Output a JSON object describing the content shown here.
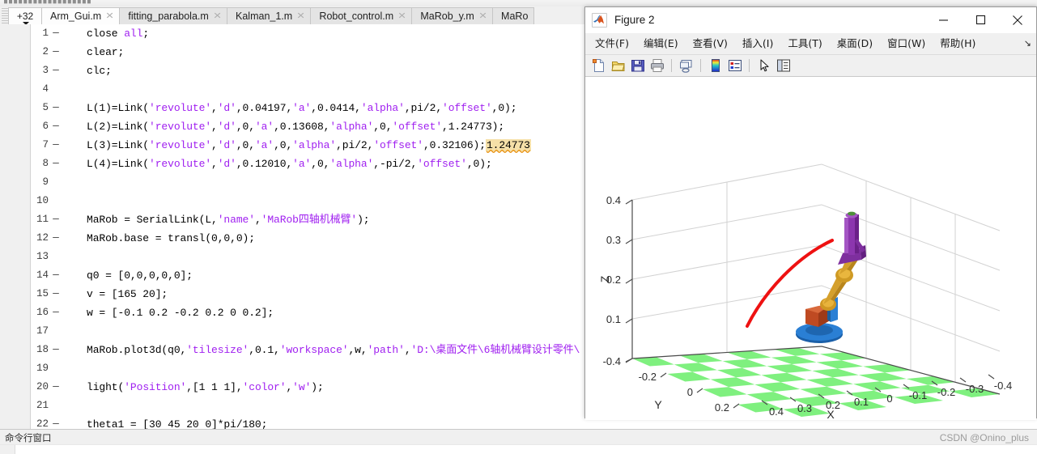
{
  "editor": {
    "tab_overflow_label": "+32",
    "tabs": [
      {
        "label": "Arm_Gui.m",
        "close": "✕",
        "active": true
      },
      {
        "label": "fitting_parabola.m",
        "close": "✕",
        "active": false
      },
      {
        "label": "Kalman_1.m",
        "close": "✕",
        "active": false
      },
      {
        "label": "Robot_control.m",
        "close": "✕",
        "active": false
      },
      {
        "label": "MaRob_y.m",
        "close": "✕",
        "active": false
      },
      {
        "label": "MaRo",
        "close": "",
        "active": false
      }
    ],
    "lines": [
      {
        "num": "1",
        "dash": "—",
        "segments": [
          {
            "t": "close ",
            "c": "p"
          },
          {
            "t": "all",
            "c": "k"
          },
          {
            "t": ";",
            "c": "p"
          }
        ]
      },
      {
        "num": "2",
        "dash": "—",
        "segments": [
          {
            "t": "clear;",
            "c": "p"
          }
        ]
      },
      {
        "num": "3",
        "dash": "—",
        "segments": [
          {
            "t": "clc;",
            "c": "p"
          }
        ]
      },
      {
        "num": "4",
        "dash": "",
        "segments": []
      },
      {
        "num": "5",
        "dash": "—",
        "segments": [
          {
            "t": "L(1)=Link(",
            "c": "p"
          },
          {
            "t": "'revolute'",
            "c": "s"
          },
          {
            "t": ",",
            "c": "p"
          },
          {
            "t": "'d'",
            "c": "s"
          },
          {
            "t": ",0.04197,",
            "c": "p"
          },
          {
            "t": "'a'",
            "c": "s"
          },
          {
            "t": ",0.0414,",
            "c": "p"
          },
          {
            "t": "'alpha'",
            "c": "s"
          },
          {
            "t": ",pi/2,",
            "c": "p"
          },
          {
            "t": "'offset'",
            "c": "s"
          },
          {
            "t": ",0);",
            "c": "p"
          }
        ]
      },
      {
        "num": "6",
        "dash": "—",
        "segments": [
          {
            "t": "L(2)=Link(",
            "c": "p"
          },
          {
            "t": "'revolute'",
            "c": "s"
          },
          {
            "t": ",",
            "c": "p"
          },
          {
            "t": "'d'",
            "c": "s"
          },
          {
            "t": ",0,",
            "c": "p"
          },
          {
            "t": "'a'",
            "c": "s"
          },
          {
            "t": ",0.13608,",
            "c": "p"
          },
          {
            "t": "'alpha'",
            "c": "s"
          },
          {
            "t": ",0,",
            "c": "p"
          },
          {
            "t": "'offset'",
            "c": "s"
          },
          {
            "t": ",1.24773);",
            "c": "p"
          }
        ]
      },
      {
        "num": "7",
        "dash": "—",
        "segments": [
          {
            "t": "L(3)=Link(",
            "c": "p"
          },
          {
            "t": "'revolute'",
            "c": "s"
          },
          {
            "t": ",",
            "c": "p"
          },
          {
            "t": "'d'",
            "c": "s"
          },
          {
            "t": ",0,",
            "c": "p"
          },
          {
            "t": "'a'",
            "c": "s"
          },
          {
            "t": ",0,",
            "c": "p"
          },
          {
            "t": "'alpha'",
            "c": "s"
          },
          {
            "t": ",pi/2,",
            "c": "p"
          },
          {
            "t": "'offset'",
            "c": "s"
          },
          {
            "t": ",0.32106);",
            "c": "p"
          },
          {
            "t": "1.24773",
            "c": "h"
          }
        ]
      },
      {
        "num": "8",
        "dash": "—",
        "segments": [
          {
            "t": "L(4)=Link(",
            "c": "p"
          },
          {
            "t": "'revolute'",
            "c": "s"
          },
          {
            "t": ",",
            "c": "p"
          },
          {
            "t": "'d'",
            "c": "s"
          },
          {
            "t": ",0.12010,",
            "c": "p"
          },
          {
            "t": "'a'",
            "c": "s"
          },
          {
            "t": ",0,",
            "c": "p"
          },
          {
            "t": "'alpha'",
            "c": "s"
          },
          {
            "t": ",-pi/2,",
            "c": "p"
          },
          {
            "t": "'offset'",
            "c": "s"
          },
          {
            "t": ",0);",
            "c": "p"
          }
        ]
      },
      {
        "num": "9",
        "dash": "",
        "segments": []
      },
      {
        "num": "10",
        "dash": "",
        "segments": []
      },
      {
        "num": "11",
        "dash": "—",
        "segments": [
          {
            "t": "MaRob = SerialLink(L,",
            "c": "p"
          },
          {
            "t": "'name'",
            "c": "s"
          },
          {
            "t": ",",
            "c": "p"
          },
          {
            "t": "'MaRob四轴机械臂'",
            "c": "s"
          },
          {
            "t": ");",
            "c": "p"
          }
        ]
      },
      {
        "num": "12",
        "dash": "—",
        "segments": [
          {
            "t": "MaRob.base = transl(0,0,0);",
            "c": "p"
          }
        ]
      },
      {
        "num": "13",
        "dash": "",
        "segments": []
      },
      {
        "num": "14",
        "dash": "—",
        "segments": [
          {
            "t": "q0 = [0,0,0,0,0];",
            "c": "p"
          }
        ]
      },
      {
        "num": "15",
        "dash": "—",
        "segments": [
          {
            "t": "v = [165 20];",
            "c": "p"
          }
        ]
      },
      {
        "num": "16",
        "dash": "—",
        "segments": [
          {
            "t": "w = [-0.1 0.2 -0.2 0.2 0 0.2];",
            "c": "p"
          }
        ]
      },
      {
        "num": "17",
        "dash": "",
        "segments": []
      },
      {
        "num": "18",
        "dash": "—",
        "segments": [
          {
            "t": "MaRob.plot3d(q0,",
            "c": "p"
          },
          {
            "t": "'tilesize'",
            "c": "s"
          },
          {
            "t": ",0.1,",
            "c": "p"
          },
          {
            "t": "'workspace'",
            "c": "s"
          },
          {
            "t": ",w,",
            "c": "p"
          },
          {
            "t": "'path'",
            "c": "s"
          },
          {
            "t": ",",
            "c": "p"
          },
          {
            "t": "'D:\\桌面文件\\6轴机械臂设计零件\\",
            "c": "s"
          }
        ]
      },
      {
        "num": "19",
        "dash": "",
        "segments": []
      },
      {
        "num": "20",
        "dash": "—",
        "segments": [
          {
            "t": "light(",
            "c": "p"
          },
          {
            "t": "'Position'",
            "c": "s"
          },
          {
            "t": ",[1 1 1],",
            "c": "p"
          },
          {
            "t": "'color'",
            "c": "s"
          },
          {
            "t": ",",
            "c": "p"
          },
          {
            "t": "'w'",
            "c": "s"
          },
          {
            "t": ");",
            "c": "p"
          }
        ]
      },
      {
        "num": "21",
        "dash": "",
        "segments": []
      },
      {
        "num": "22",
        "dash": "—",
        "segments": [
          {
            "t": "theta1 = [30 45 20 0]*pi/180;",
            "c": "p"
          }
        ]
      }
    ]
  },
  "statusbar": {
    "label": "命令行窗口",
    "watermark": "CSDN @Onino_plus"
  },
  "figure": {
    "title": "Figure 2",
    "window_buttons": {
      "minimize": "minimize-icon",
      "maximize": "maximize-icon",
      "close": "close-icon"
    },
    "menu": [
      "文件(F)",
      "编辑(E)",
      "查看(V)",
      "插入(I)",
      "工具(T)",
      "桌面(D)",
      "窗口(W)",
      "帮助(H)"
    ],
    "menu_overflow": "↘",
    "toolbar_icons": [
      "new-figure-icon",
      "open-file-icon",
      "save-figure-icon",
      "print-figure-icon",
      "link-plot-icon",
      "colorbar-icon",
      "legend-icon",
      "pointer-icon",
      "plot-browser-icon"
    ]
  },
  "chart_data": {
    "type": "scatter",
    "title": "",
    "xlabel": "X",
    "ylabel": "Y",
    "zlabel": "Z",
    "xticks": [
      "0.4",
      "0.3",
      "0.2",
      "0.1",
      "0",
      "-0.1",
      "-0.2",
      "-0.3",
      "-0.4"
    ],
    "yticks": [
      "-0.4",
      "-0.2",
      "0",
      "0.2",
      "0.4"
    ],
    "zticks": [
      "0.1",
      "0.2",
      "0.3",
      "0.4"
    ],
    "xlim": [
      -0.4,
      0.4
    ],
    "ylim": [
      -0.4,
      0.4
    ],
    "zlim": [
      -0.1,
      0.4
    ],
    "grid": true,
    "legend": "none",
    "annotations": [
      {
        "name": "trajectory-path",
        "color": "#ee1111",
        "description": "red arc trajectory curve"
      },
      {
        "name": "robot-arm-model",
        "description": "4-axis robot arm 3D model"
      },
      {
        "name": "checkerboard-floor",
        "colors": [
          "#7ff07f",
          "#ffffff"
        ],
        "tilesize": 0.1
      }
    ]
  }
}
